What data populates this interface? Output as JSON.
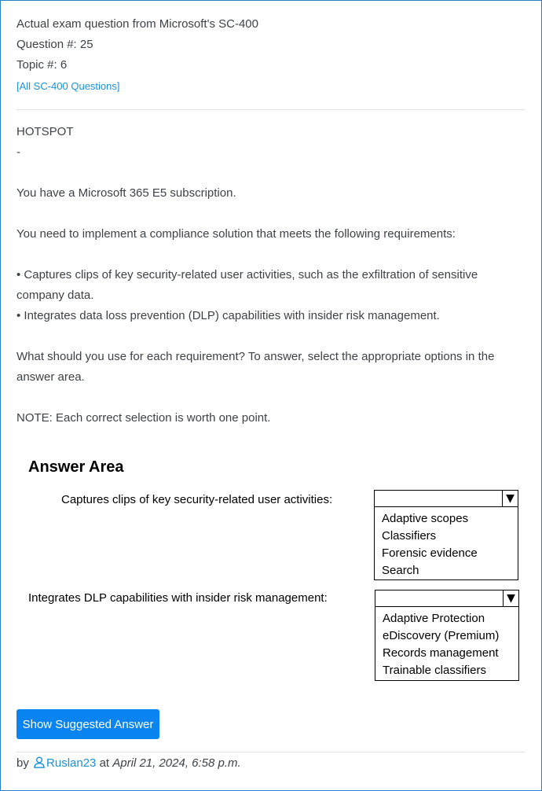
{
  "header": {
    "title_line": "Actual exam question from Microsoft's SC-400",
    "question_line": "Question #: 25",
    "topic_line": "Topic #: 6",
    "all_questions_link": "[All SC-400 Questions]"
  },
  "question": {
    "type": "HOTSPOT",
    "dash": "-",
    "p1": "You have a Microsoft 365 E5 subscription.",
    "p2": "You need to implement a compliance solution that meets the following requirements:",
    "bullet1": "• Captures clips of key security-related user activities, such as the exfiltration of sensitive company data.",
    "bullet2": "• Integrates data loss prevention (DLP) capabilities with insider risk management.",
    "p3": "What should you use for each requirement? To answer, select the appropriate options in the answer area.",
    "note": "NOTE: Each correct selection is worth one point."
  },
  "answer_area": {
    "title": "Answer Area",
    "row1": {
      "label": "Captures clips of key security-related user activities:",
      "options": [
        "Adaptive scopes",
        "Classifiers",
        "Forensic evidence",
        "Search"
      ]
    },
    "row2": {
      "label": "Integrates DLP capabilities with insider risk management:",
      "options": [
        "Adaptive Protection",
        "eDiscovery (Premium)",
        "Records management",
        "Trainable classifiers"
      ]
    },
    "arrow_glyph": "▼"
  },
  "actions": {
    "show_answer_label": "Show Suggested Answer"
  },
  "footer": {
    "by": "by",
    "user": "Ruslan23",
    "at": "at",
    "date": "April 21, 2024, 6:58 p.m."
  },
  "colors": {
    "accent": "#0a84f0",
    "link": "#1a91da",
    "border": "#2a7fc8"
  }
}
